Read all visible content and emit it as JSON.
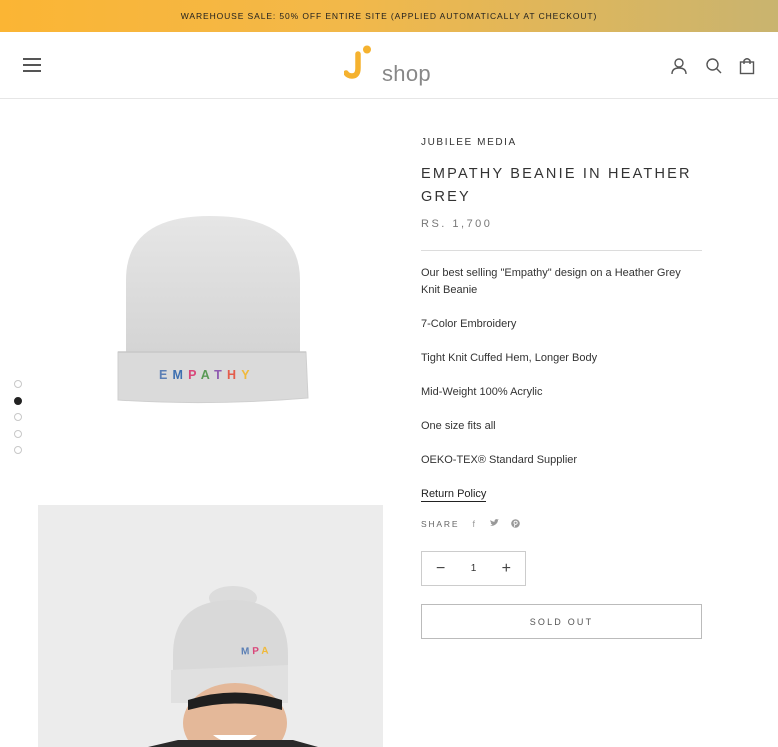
{
  "announcement": {
    "text": "WAREHOUSE SALE: 50% OFF ENTIRE SITE (APPLIED AUTOMATICALLY AT CHECKOUT)"
  },
  "header": {
    "logo_text": "shop",
    "icons": [
      "menu-icon",
      "account-icon",
      "search-icon",
      "cart-icon"
    ]
  },
  "gallery": {
    "slide_count": 5,
    "active_slide": 2,
    "beanie_embroidery": [
      "E",
      "M",
      "P",
      "A",
      "T",
      "H",
      "Y"
    ],
    "embroidery_colors": [
      "#5b7fb5",
      "#3d6fb0",
      "#d9477a",
      "#5a9a56",
      "#8e5ab0",
      "#e45c4b",
      "#f0b93a"
    ],
    "photo_embroidery": [
      "M",
      "P",
      "A"
    ],
    "photo_embroidery_colors": [
      "#5b7fb5",
      "#d9477a",
      "#f0b93a"
    ]
  },
  "product": {
    "vendor": "JUBILEE MEDIA",
    "title": "EMPATHY BEANIE IN HEATHER GREY",
    "price": "RS. 1,700",
    "description": [
      "Our best selling \"Empathy\" design on a Heather Grey Knit Beanie",
      "7-Color Embroidery",
      "Tight Knit Cuffed Hem, Longer Body",
      "Mid-Weight 100% Acrylic",
      "One size fits all",
      "OEKO-TEX® Standard Supplier"
    ],
    "return_policy": "Return Policy",
    "share_label": "SHARE",
    "share_icons": [
      "facebook-icon",
      "twitter-icon",
      "pinterest-icon"
    ],
    "quantity": "1",
    "sold_out_label": "SOLD OUT"
  },
  "colors": {
    "accent": "#fbb534",
    "logo_gold": "#f5b22f",
    "text": "#333333"
  }
}
